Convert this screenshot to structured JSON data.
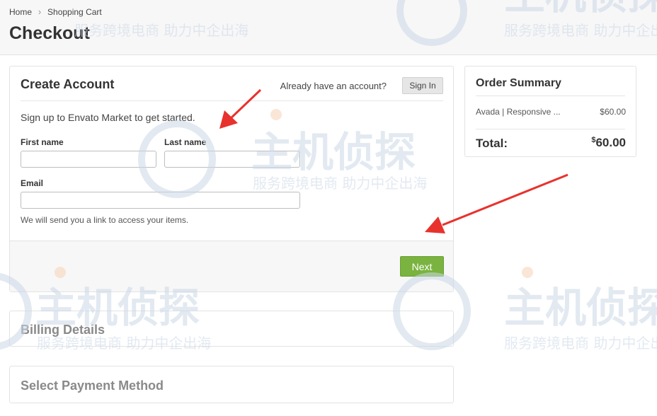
{
  "breadcrumb": {
    "items": [
      "Home",
      "Shopping Cart"
    ]
  },
  "page": {
    "title": "Checkout"
  },
  "create_account": {
    "title": "Create Account",
    "already_text": "Already have an account?",
    "sign_in_label": "Sign In",
    "intro": "Sign up to Envato Market to get started.",
    "first_name_label": "First name",
    "first_name_value": "",
    "last_name_label": "Last name",
    "last_name_value": "",
    "email_label": "Email",
    "email_value": "",
    "email_hint": "We will send you a link to access your items.",
    "next_label": "Next"
  },
  "billing": {
    "title": "Billing Details"
  },
  "payment": {
    "title": "Select Payment Method"
  },
  "summary": {
    "title": "Order Summary",
    "item_name": "Avada | Responsive ...",
    "item_price": "$60.00",
    "total_label": "Total:",
    "total_currency": "$",
    "total_value": "60.00"
  },
  "watermark": {
    "logo_text": "主机侦探",
    "sub_text": "服务跨境电商 助力中企出海"
  },
  "colors": {
    "accent_green": "#7ab33f",
    "annotation_red": "#e8322d"
  },
  "icons": [
    "chevron-right-icon",
    "annotation-arrow"
  ]
}
